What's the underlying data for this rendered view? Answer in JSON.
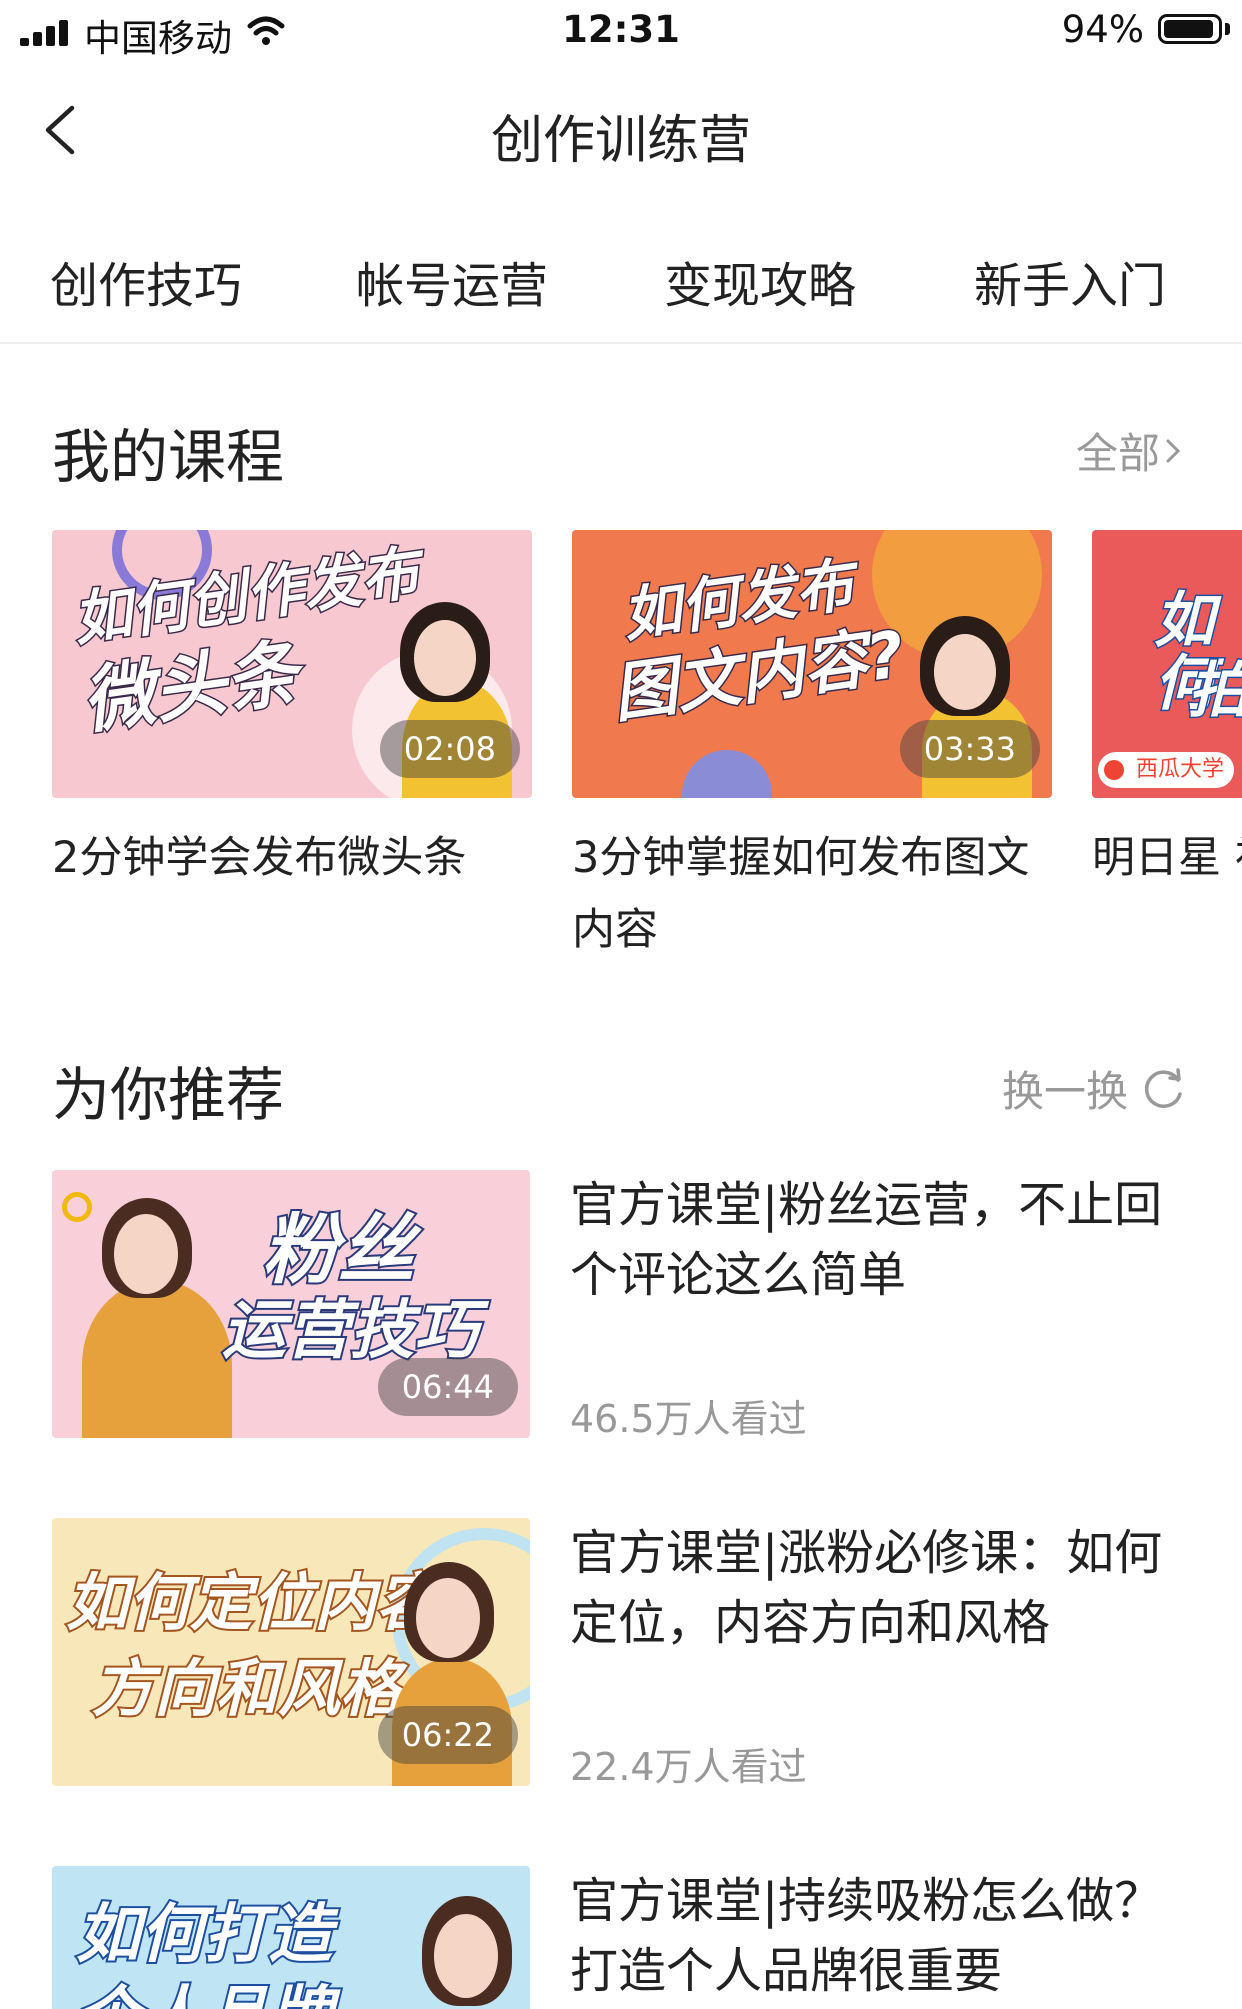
{
  "status_bar": {
    "carrier": "中国移动",
    "time": "12:31",
    "battery": "94%",
    "battery_level": 0.94
  },
  "nav": {
    "title": "创作训练营"
  },
  "tabs": [
    "创作技巧",
    "帐号运营",
    "变现攻略",
    "新手入门"
  ],
  "my_courses": {
    "title": "我的课程",
    "all_label": "全部",
    "items": [
      {
        "thumb_line1": "如何创作发布",
        "thumb_line2": "微头条",
        "duration": "02:08",
        "title": "2分钟学会发布微头条"
      },
      {
        "thumb_line1": "如何发布",
        "thumb_line2": "图文内容?",
        "duration": "03:33",
        "title": "3分钟掌握如何发布图文内容"
      },
      {
        "thumb_line1": "如何",
        "thumb_line2": "拍",
        "badge": "西瓜大学",
        "title": "明日星 视频该"
      }
    ]
  },
  "recommend": {
    "title": "为你推荐",
    "refresh_label": "换一换",
    "items": [
      {
        "thumb_line1": "粉丝",
        "thumb_line2": "运营技巧",
        "duration": "06:44",
        "title": "官方课堂|粉丝运营，不止回个评论这么简单",
        "views": "46.5万人看过"
      },
      {
        "thumb_line1": "如何定位内容",
        "thumb_line2": "方向和风格",
        "duration": "06:22",
        "title": "官方课堂|涨粉必修课：如何定位，内容方向和风格",
        "views": "22.4万人看过"
      },
      {
        "thumb_line1": "如何打造",
        "thumb_line2": "个人品牌",
        "title": "官方课堂|持续吸粉怎么做？打造个人品牌很重要"
      }
    ]
  },
  "colors": {
    "accent_orange": "#f07a4e",
    "pink_bg": "#f7c8cf",
    "yellow_bg": "#f8e7b9",
    "blue_bg": "#bfe5f5",
    "text_gray": "#999999"
  }
}
